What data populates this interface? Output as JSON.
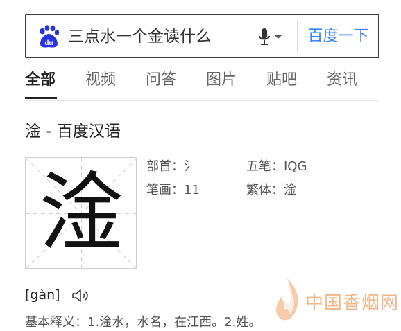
{
  "search": {
    "query": "三点水一个金读什么",
    "button_label": "百度一下"
  },
  "tabs": [
    {
      "label": "全部",
      "active": true
    },
    {
      "label": "视频",
      "active": false
    },
    {
      "label": "问答",
      "active": false
    },
    {
      "label": "图片",
      "active": false
    },
    {
      "label": "贴吧",
      "active": false
    },
    {
      "label": "资讯",
      "active": false
    }
  ],
  "result": {
    "title": "淦 - 百度汉语",
    "character": "淦",
    "info": {
      "radical_label": "部首：",
      "radical_value": "氵",
      "wubi_label": "五笔：",
      "wubi_value": "IQG",
      "strokes_label": "笔画：",
      "strokes_value": "11",
      "traditional_label": "繁体：",
      "traditional_value": "淦"
    },
    "pinyin": "[gàn]",
    "meaning": "基本释义：1.淦水，水名，在江西。2.姓。"
  },
  "watermark": {
    "text": "中国香烟网"
  },
  "colors": {
    "link_blue": "#3385ff",
    "logo_blue": "#2932e1",
    "watermark_orange": "#e87c28"
  }
}
